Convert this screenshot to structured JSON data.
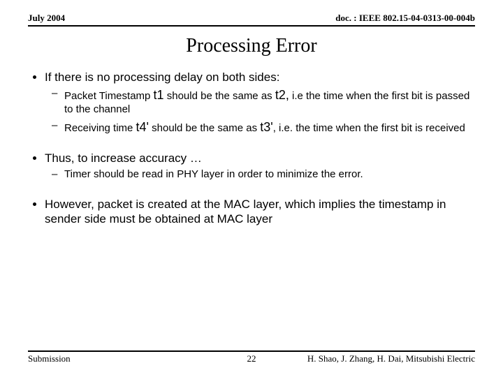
{
  "header": {
    "left": "July 2004",
    "right": "doc. : IEEE 802.15-04-0313-00-004b"
  },
  "title": "Processing Error",
  "bullets": {
    "b1": "If there is no processing delay on both sides:",
    "b1s1_a": "Packet Timestamp ",
    "b1s1_t1": "t1",
    "b1s1_b": " should be the same as ",
    "b1s1_t2": "t2,",
    "b1s1_c": " i.e the time when the first bit is passed to the channel",
    "b1s2_a": "Receiving time ",
    "b1s2_t1": "t4'",
    "b1s2_b": " should be the same as ",
    "b1s2_t2": "t3'",
    "b1s2_c": ", i.e. the time when the first bit is received",
    "b2": "Thus, to increase accuracy …",
    "b2s1": "Timer should be read in PHY layer in order to minimize the error.",
    "b3": "However, packet is created at the MAC layer, which implies the timestamp in sender side must be obtained at MAC layer"
  },
  "footer": {
    "left": "Submission",
    "center": "22",
    "right": "H. Shao, J. Zhang, H. Dai, Mitsubishi Electric"
  }
}
